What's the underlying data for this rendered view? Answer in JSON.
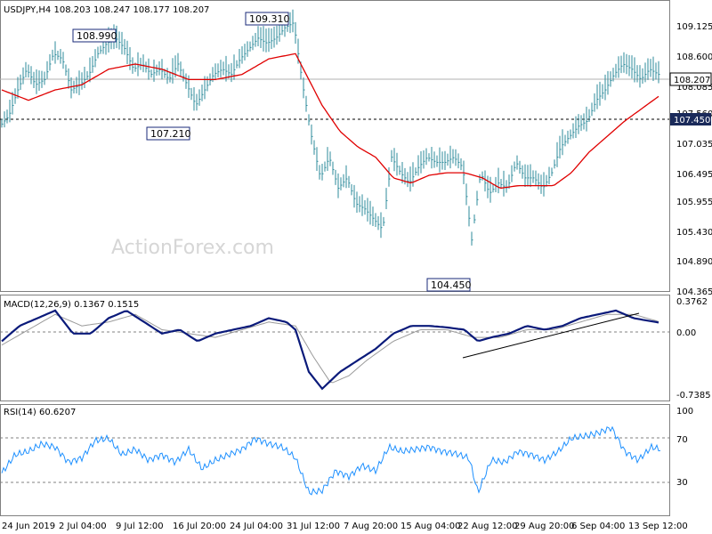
{
  "colors": {
    "bars": "#2e8b9b",
    "ma": "#e00000",
    "macd": "#0a1a7a",
    "signal": "#9a9a9a",
    "rsi": "#1e90ff",
    "grid": "#808080",
    "watermark": "#d6d6d6"
  },
  "watermark": "ActionForex.com",
  "chart_data": [
    {
      "type": "bar",
      "title": "USDJPY,H4  108.203 108.247 108.177 108.207",
      "ylim": [
        104.1,
        109.5
      ],
      "yticks": [
        "109.125",
        "108.600",
        "108.085",
        "107.560",
        "107.035",
        "106.495",
        "105.955",
        "105.430",
        "104.890",
        "104.365"
      ],
      "current_price": "108.207",
      "support_level": "107.450",
      "annotations": [
        "109.310",
        "108.990",
        "107.210",
        "104.450"
      ],
      "close_path": [
        [
          0,
          107.2
        ],
        [
          10,
          107.4
        ],
        [
          20,
          107.9
        ],
        [
          30,
          108.3
        ],
        [
          40,
          108.0
        ],
        [
          50,
          108.1
        ],
        [
          60,
          108.6
        ],
        [
          70,
          108.5
        ],
        [
          80,
          107.9
        ],
        [
          90,
          108.0
        ],
        [
          100,
          108.2
        ],
        [
          110,
          108.6
        ],
        [
          120,
          108.8
        ],
        [
          130,
          108.9
        ],
        [
          140,
          108.7
        ],
        [
          150,
          108.3
        ],
        [
          160,
          108.4
        ],
        [
          170,
          108.2
        ],
        [
          180,
          108.3
        ],
        [
          190,
          108.1
        ],
        [
          200,
          108.4
        ],
        [
          210,
          108.0
        ],
        [
          220,
          107.6
        ],
        [
          230,
          107.9
        ],
        [
          240,
          108.2
        ],
        [
          250,
          108.3
        ],
        [
          260,
          108.2
        ],
        [
          270,
          108.5
        ],
        [
          280,
          108.7
        ],
        [
          290,
          108.9
        ],
        [
          300,
          108.8
        ],
        [
          310,
          108.9
        ],
        [
          320,
          109.1
        ],
        [
          330,
          109.2
        ],
        [
          340,
          108.0
        ],
        [
          350,
          107.0
        ],
        [
          360,
          106.2
        ],
        [
          370,
          106.6
        ],
        [
          380,
          106.0
        ],
        [
          390,
          106.2
        ],
        [
          400,
          105.7
        ],
        [
          410,
          105.6
        ],
        [
          420,
          105.4
        ],
        [
          430,
          105.2
        ],
        [
          440,
          106.6
        ],
        [
          450,
          106.3
        ],
        [
          460,
          106.1
        ],
        [
          470,
          106.4
        ],
        [
          480,
          106.6
        ],
        [
          490,
          106.5
        ],
        [
          500,
          106.5
        ],
        [
          510,
          106.6
        ],
        [
          520,
          106.4
        ],
        [
          530,
          105.0
        ],
        [
          540,
          106.3
        ],
        [
          550,
          105.9
        ],
        [
          560,
          106.1
        ],
        [
          570,
          106.0
        ],
        [
          580,
          106.5
        ],
        [
          590,
          106.2
        ],
        [
          600,
          106.2
        ],
        [
          610,
          106.0
        ],
        [
          620,
          106.3
        ],
        [
          630,
          106.8
        ],
        [
          640,
          107.0
        ],
        [
          650,
          107.2
        ],
        [
          660,
          107.3
        ],
        [
          670,
          107.7
        ],
        [
          680,
          107.9
        ],
        [
          690,
          108.2
        ],
        [
          700,
          108.4
        ],
        [
          710,
          108.3
        ],
        [
          720,
          108.1
        ],
        [
          730,
          108.3
        ],
        [
          740,
          108.2
        ]
      ],
      "ma_path": [
        [
          0,
          107.9
        ],
        [
          30,
          107.7
        ],
        [
          60,
          107.9
        ],
        [
          90,
          108.0
        ],
        [
          120,
          108.3
        ],
        [
          150,
          108.4
        ],
        [
          180,
          108.3
        ],
        [
          210,
          108.1
        ],
        [
          240,
          108.1
        ],
        [
          270,
          108.2
        ],
        [
          300,
          108.5
        ],
        [
          330,
          108.6
        ],
        [
          345,
          108.1
        ],
        [
          360,
          107.6
        ],
        [
          380,
          107.1
        ],
        [
          400,
          106.8
        ],
        [
          420,
          106.6
        ],
        [
          440,
          106.2
        ],
        [
          460,
          106.1
        ],
        [
          480,
          106.25
        ],
        [
          500,
          106.3
        ],
        [
          520,
          106.3
        ],
        [
          540,
          106.2
        ],
        [
          560,
          106.0
        ],
        [
          580,
          106.05
        ],
        [
          600,
          106.05
        ],
        [
          620,
          106.05
        ],
        [
          640,
          106.3
        ],
        [
          660,
          106.7
        ],
        [
          680,
          107.0
        ],
        [
          700,
          107.3
        ],
        [
          720,
          107.55
        ],
        [
          740,
          107.8
        ]
      ]
    },
    {
      "type": "line",
      "title": "MACD(12,26,9) 0.1367 0.1515",
      "ylim": [
        -0.85,
        0.45
      ],
      "yticks": [
        "0.3762",
        "0.00",
        "-0.7385"
      ],
      "macd_path": [
        [
          0,
          -0.1
        ],
        [
          20,
          0.1
        ],
        [
          40,
          0.2
        ],
        [
          60,
          0.3
        ],
        [
          80,
          0.0
        ],
        [
          100,
          0.0
        ],
        [
          120,
          0.2
        ],
        [
          140,
          0.3
        ],
        [
          160,
          0.15
        ],
        [
          180,
          0.0
        ],
        [
          200,
          0.05
        ],
        [
          220,
          -0.1
        ],
        [
          240,
          0.0
        ],
        [
          260,
          0.05
        ],
        [
          280,
          0.1
        ],
        [
          300,
          0.2
        ],
        [
          320,
          0.15
        ],
        [
          330,
          0.05
        ],
        [
          345,
          -0.5
        ],
        [
          360,
          -0.72
        ],
        [
          380,
          -0.5
        ],
        [
          400,
          -0.35
        ],
        [
          420,
          -0.2
        ],
        [
          440,
          0.0
        ],
        [
          460,
          0.1
        ],
        [
          480,
          0.1
        ],
        [
          500,
          0.08
        ],
        [
          520,
          0.05
        ],
        [
          535,
          -0.1
        ],
        [
          550,
          -0.05
        ],
        [
          570,
          0.0
        ],
        [
          590,
          0.1
        ],
        [
          610,
          0.05
        ],
        [
          630,
          0.1
        ],
        [
          650,
          0.2
        ],
        [
          670,
          0.25
        ],
        [
          690,
          0.3
        ],
        [
          710,
          0.2
        ],
        [
          740,
          0.14
        ]
      ],
      "signal_path": [
        [
          0,
          -0.15
        ],
        [
          30,
          0.05
        ],
        [
          60,
          0.25
        ],
        [
          90,
          0.1
        ],
        [
          120,
          0.15
        ],
        [
          150,
          0.25
        ],
        [
          180,
          0.05
        ],
        [
          210,
          0.0
        ],
        [
          240,
          -0.05
        ],
        [
          270,
          0.05
        ],
        [
          300,
          0.15
        ],
        [
          330,
          0.1
        ],
        [
          350,
          -0.3
        ],
        [
          370,
          -0.65
        ],
        [
          390,
          -0.55
        ],
        [
          410,
          -0.35
        ],
        [
          440,
          -0.1
        ],
        [
          470,
          0.05
        ],
        [
          500,
          0.05
        ],
        [
          530,
          -0.05
        ],
        [
          560,
          -0.05
        ],
        [
          590,
          0.05
        ],
        [
          620,
          0.05
        ],
        [
          650,
          0.15
        ],
        [
          680,
          0.25
        ],
        [
          710,
          0.25
        ],
        [
          740,
          0.15
        ]
      ]
    },
    {
      "type": "line",
      "title": "RSI(14) 60.6207",
      "ylim": [
        0,
        100
      ],
      "yticks": [
        "100",
        "70",
        "30"
      ],
      "levels": [
        70,
        30
      ],
      "rsi_path": [
        [
          0,
          38
        ],
        [
          15,
          55
        ],
        [
          30,
          58
        ],
        [
          45,
          65
        ],
        [
          60,
          62
        ],
        [
          75,
          48
        ],
        [
          90,
          52
        ],
        [
          105,
          68
        ],
        [
          120,
          70
        ],
        [
          135,
          55
        ],
        [
          150,
          60
        ],
        [
          165,
          50
        ],
        [
          180,
          55
        ],
        [
          195,
          48
        ],
        [
          210,
          60
        ],
        [
          225,
          42
        ],
        [
          240,
          50
        ],
        [
          255,
          55
        ],
        [
          270,
          60
        ],
        [
          285,
          70
        ],
        [
          300,
          65
        ],
        [
          315,
          62
        ],
        [
          330,
          52
        ],
        [
          345,
          20
        ],
        [
          360,
          22
        ],
        [
          375,
          40
        ],
        [
          390,
          35
        ],
        [
          405,
          45
        ],
        [
          420,
          40
        ],
        [
          435,
          62
        ],
        [
          450,
          58
        ],
        [
          465,
          60
        ],
        [
          480,
          62
        ],
        [
          495,
          58
        ],
        [
          510,
          56
        ],
        [
          525,
          52
        ],
        [
          535,
          20
        ],
        [
          550,
          50
        ],
        [
          565,
          48
        ],
        [
          580,
          58
        ],
        [
          595,
          55
        ],
        [
          610,
          50
        ],
        [
          625,
          58
        ],
        [
          640,
          70
        ],
        [
          655,
          72
        ],
        [
          670,
          75
        ],
        [
          685,
          80
        ],
        [
          700,
          58
        ],
        [
          715,
          50
        ],
        [
          730,
          62
        ],
        [
          740,
          60
        ]
      ]
    }
  ],
  "xaxis_labels": [
    "24 Jun 2019",
    "2 Jul 04:00",
    "9 Jul 12:00",
    "16 Jul 20:00",
    "24 Jul 04:00",
    "31 Jul 12:00",
    "7 Aug 20:00",
    "15 Aug 04:00",
    "22 Aug 12:00",
    "29 Aug 20:00",
    "6 Sep 04:00",
    "13 Sep 12:00"
  ]
}
